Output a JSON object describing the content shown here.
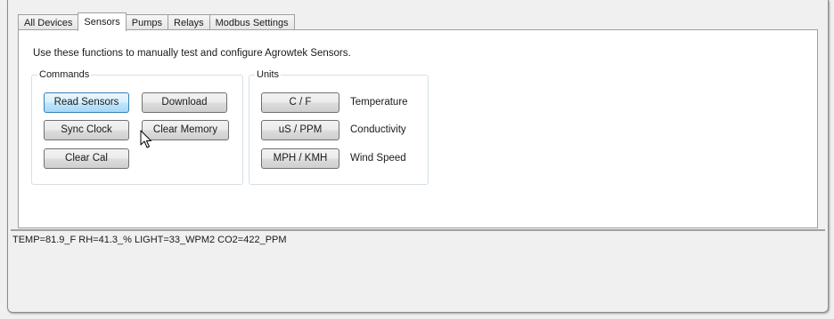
{
  "tabs": [
    {
      "label": "All Devices"
    },
    {
      "label": "Sensors"
    },
    {
      "label": "Pumps"
    },
    {
      "label": "Relays"
    },
    {
      "label": "Modbus Settings"
    }
  ],
  "active_tab": "Sensors",
  "instructions": "Use these functions to manually test and configure Agrowtek Sensors.",
  "commands": {
    "title": "Commands",
    "read_sensors": "Read Sensors",
    "download": "Download",
    "sync_clock": "Sync Clock",
    "clear_memory": "Clear Memory",
    "clear_cal": "Clear Cal"
  },
  "units": {
    "title": "Units",
    "rows": [
      {
        "button": "C / F",
        "label": "Temperature"
      },
      {
        "button": "uS / PPM",
        "label": "Conductivity"
      },
      {
        "button": "MPH / KMH",
        "label": "Wind Speed"
      }
    ]
  },
  "output": {
    "text": "TEMP=81.9_F RH=41.3_% LIGHT=33_WPM2 CO2=422_PPM"
  },
  "colors": {
    "hover_button_border": "#3c7fb1",
    "hover_button_fill": "#bee6fd"
  },
  "icons": {
    "cursor": "mouse-pointer-icon"
  }
}
